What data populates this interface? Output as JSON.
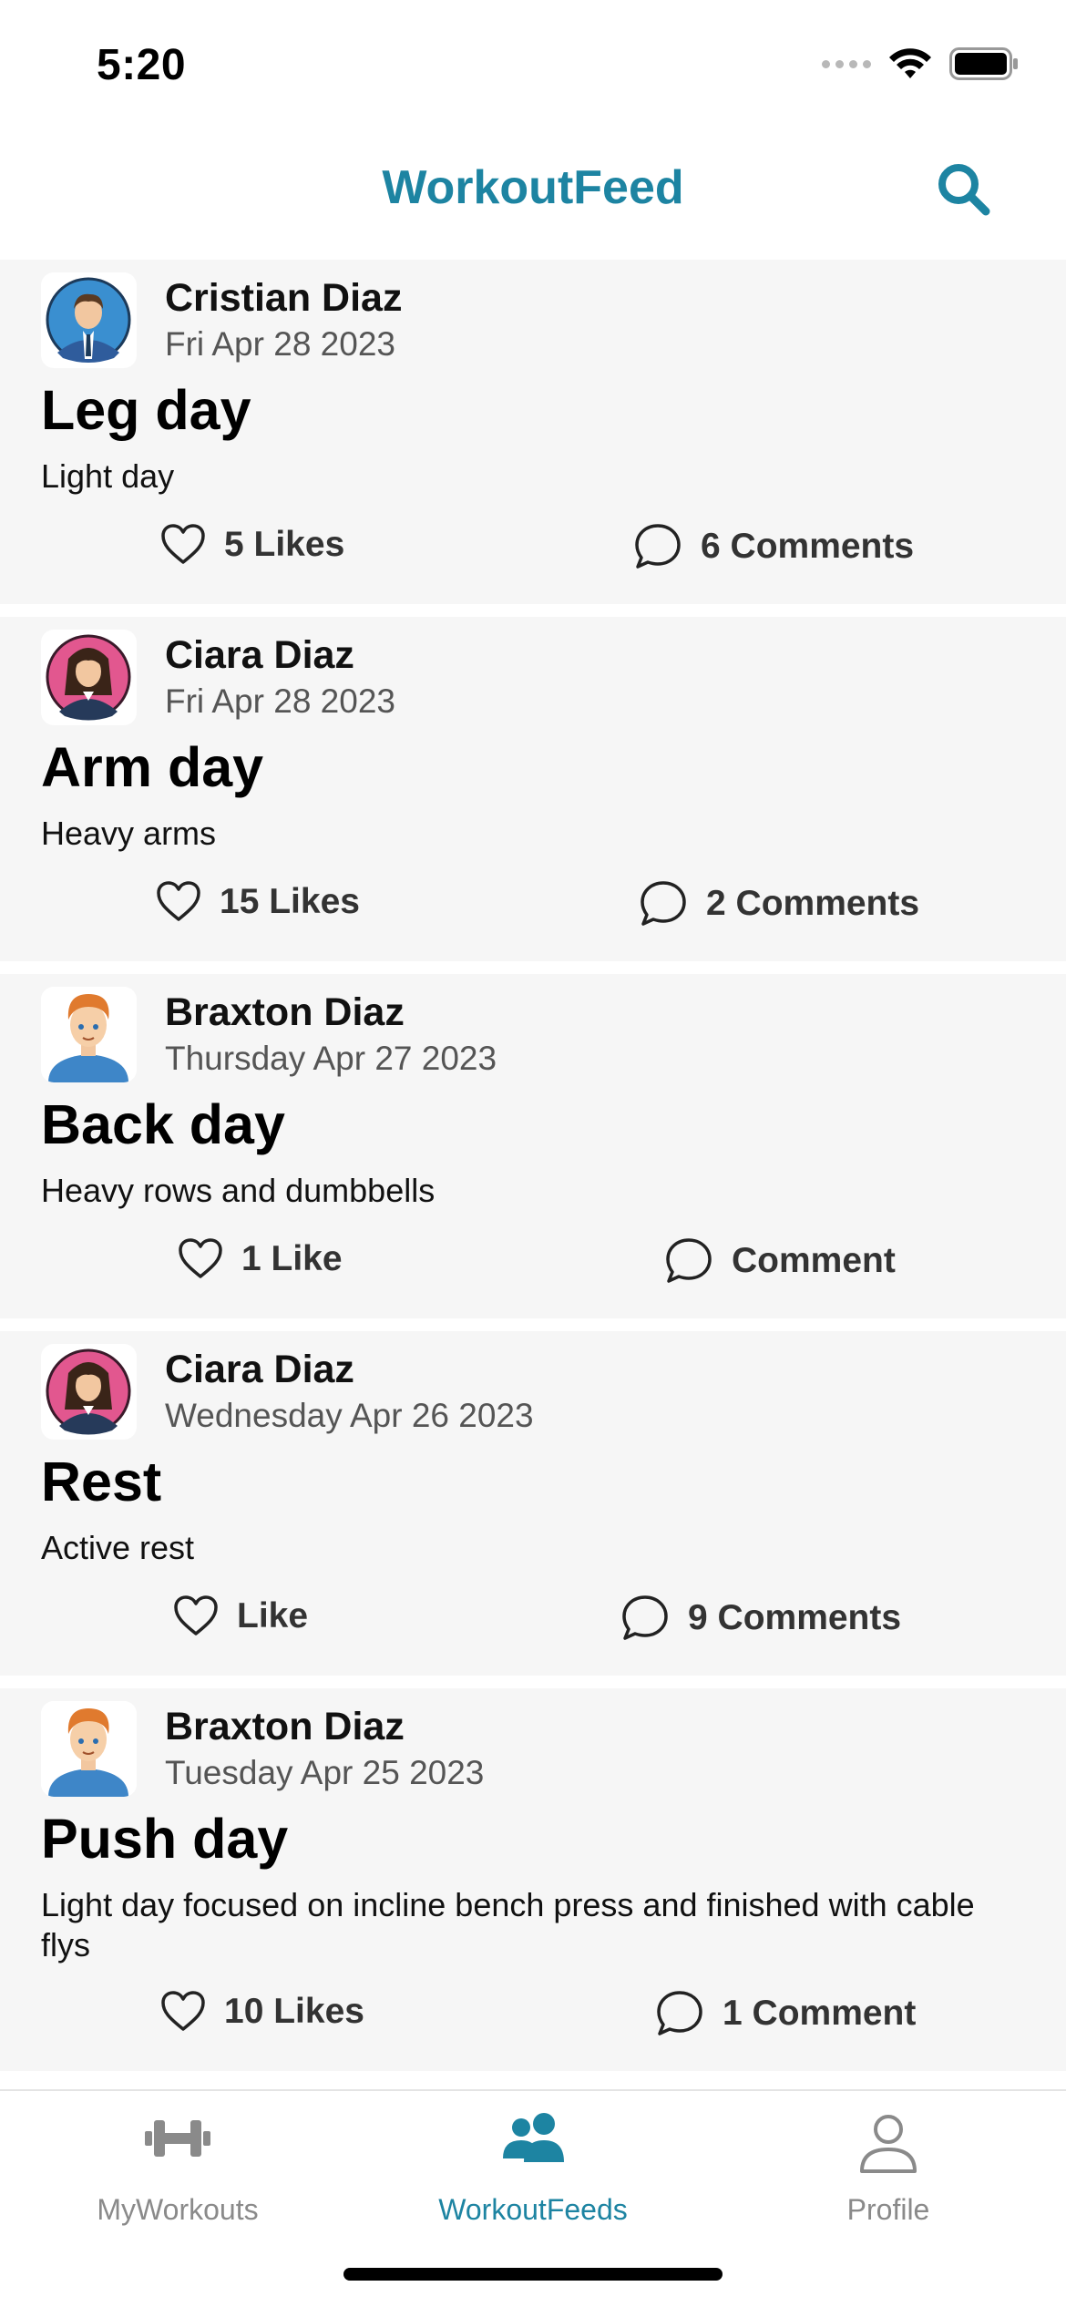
{
  "status_bar": {
    "time": "5:20"
  },
  "header": {
    "title": "WorkoutFeed"
  },
  "posts": [
    {
      "author": "Cristian Diaz",
      "date": "Fri Apr 28 2023",
      "title": "Leg day",
      "description": "Light day",
      "likes_label": "5 Likes",
      "comments_label": "6 Comments",
      "avatar": "man-in-suit-avatar"
    },
    {
      "author": "Ciara Diaz",
      "date": "Fri Apr 28 2023",
      "title": "Arm day",
      "description": "Heavy arms",
      "likes_label": "15 Likes",
      "comments_label": "2 Comments",
      "avatar": "woman-avatar"
    },
    {
      "author": "Braxton Diaz",
      "date": "Thursday Apr 27 2023",
      "title": "Back day",
      "description": "Heavy rows and dumbbells",
      "likes_label": "1 Like",
      "comments_label": "Comment",
      "avatar": "red-haired-man-avatar"
    },
    {
      "author": "Ciara Diaz",
      "date": "Wednesday Apr 26 2023",
      "title": "Rest",
      "description": "Active rest",
      "likes_label": "Like",
      "comments_label": "9 Comments",
      "avatar": "woman-avatar"
    },
    {
      "author": "Braxton Diaz",
      "date": "Tuesday Apr 25 2023",
      "title": "Push day",
      "description": "Light day focused on incline bench press and finished with cable flys",
      "likes_label": "10 Likes",
      "comments_label": "1 Comment",
      "avatar": "red-haired-man-avatar"
    }
  ],
  "tab_bar": {
    "tabs": [
      {
        "label": "MyWorkouts",
        "icon": "dumbbell-icon",
        "active": false
      },
      {
        "label": "WorkoutFeeds",
        "icon": "people-icon",
        "active": true
      },
      {
        "label": "Profile",
        "icon": "person-icon",
        "active": false
      }
    ]
  },
  "colors": {
    "accent": "#1d84a2",
    "card_background": "#f6f6f6",
    "inactive": "#8a8a8a"
  }
}
